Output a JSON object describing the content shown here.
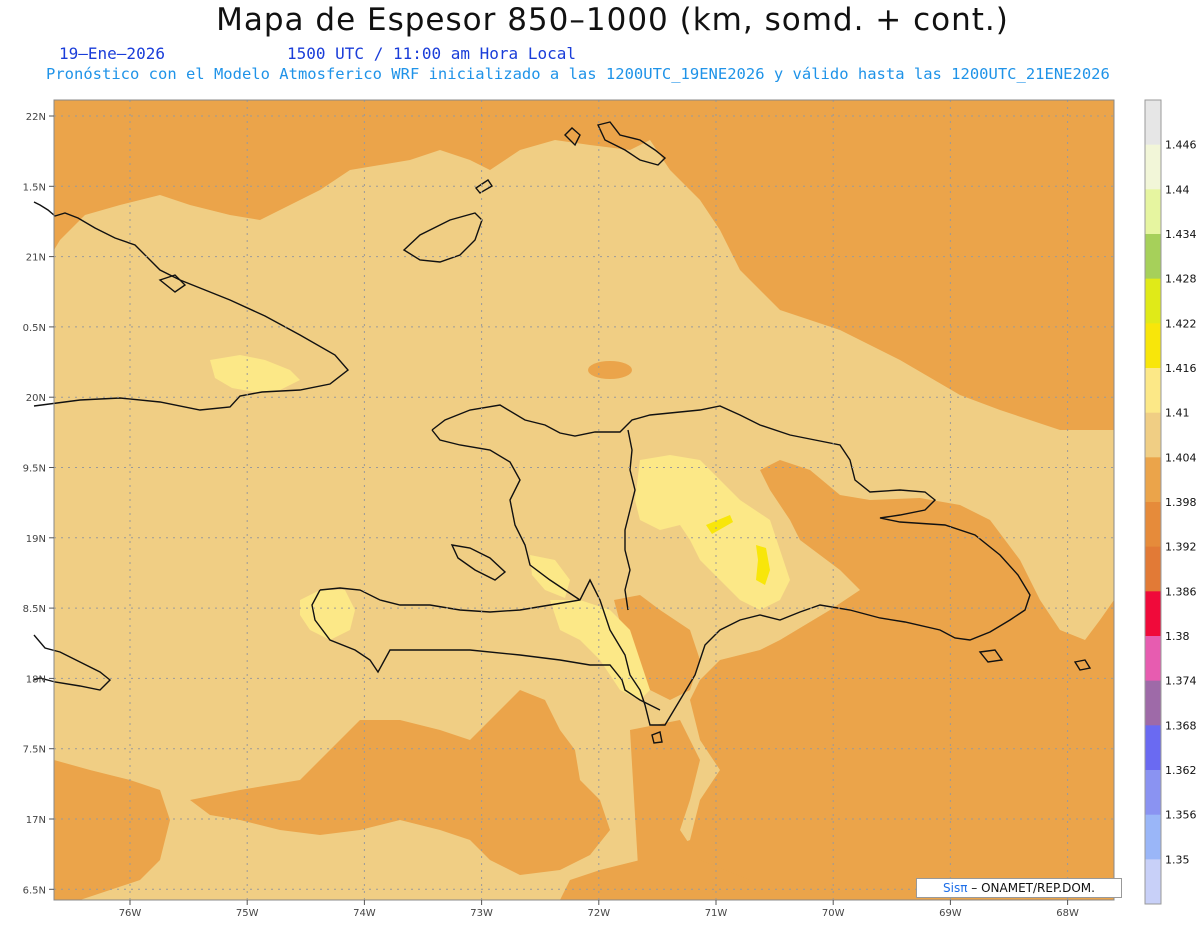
{
  "title": "Mapa de Espesor 850–1000 (km, somd. + cont.)",
  "date": "19–Ene–2026",
  "time": "1500 UTC / 11:00 am Hora Local",
  "forecast": "Pronóstico con el Modelo Atmosferico WRF inicializado a las 1200UTC_19ENE2026 y válido hasta las  1200UTC_21ENE2026",
  "credit": {
    "brand": "Sisπ",
    "text": "– ONAMET/REP.DOM."
  },
  "lat_labels": [
    "22N",
    "1.5N",
    "21N",
    "0.5N",
    "20N",
    "9.5N",
    "19N",
    "8.5N",
    "18N",
    "7.5N",
    "17N",
    "6.5N"
  ],
  "lon_labels": [
    "76W",
    "75W",
    "74W",
    "73W",
    "72W",
    "71W",
    "70W",
    "69W",
    "68W"
  ],
  "colorbar": {
    "labels": [
      "1.446",
      "1.44",
      "1.434",
      "1.428",
      "1.422",
      "1.416",
      "1.41",
      "1.404",
      "1.398",
      "1.392",
      "1.386",
      "1.38",
      "1.374",
      "1.368",
      "1.362",
      "1.356",
      "1.35"
    ],
    "colors": [
      "#e6e6e6",
      "#f2f6d8",
      "#e6f5a0",
      "#a6d05a",
      "#e0ea18",
      "#f8e60a",
      "#fce887",
      "#f0ce84",
      "#eba44a",
      "#e68b3a",
      "#e27a36",
      "#f00a3a",
      "#e75cb0",
      "#9e6aa8",
      "#6a6af2",
      "#8a93f2",
      "#9ab6f8",
      "#c8d0f8"
    ]
  },
  "palette": {
    "sea_dark": "#eba44a",
    "land_light": "#f0ce84",
    "yellow": "#fce887",
    "bright_yellow": "#f8e60a",
    "coast": "#111111"
  }
}
